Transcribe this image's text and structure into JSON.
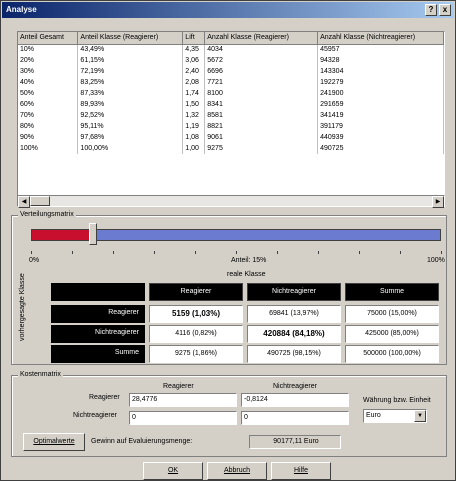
{
  "window": {
    "title": "Analyse",
    "help_icon": "?",
    "close_icon": "x"
  },
  "table": {
    "headers": [
      "Anteil Gesamt",
      "Anteil Klasse (Reagierer)",
      "Lift",
      "Anzahl Klasse (Reagierer)",
      "Anzahl Klasse (Nichtreagierer)"
    ],
    "rows": [
      [
        "10%",
        "43,49%",
        "4,35",
        "4034",
        "45957"
      ],
      [
        "20%",
        "61,15%",
        "3,06",
        "5672",
        "94328"
      ],
      [
        "30%",
        "72,19%",
        "2,40",
        "6696",
        "143304"
      ],
      [
        "40%",
        "83,25%",
        "2,08",
        "7721",
        "192279"
      ],
      [
        "50%",
        "87,33%",
        "1,74",
        "8100",
        "241900"
      ],
      [
        "60%",
        "89,93%",
        "1,50",
        "8341",
        "291659"
      ],
      [
        "70%",
        "92,52%",
        "1,32",
        "8581",
        "341419"
      ],
      [
        "80%",
        "95,11%",
        "1,19",
        "8821",
        "391179"
      ],
      [
        "90%",
        "97,68%",
        "1,08",
        "9061",
        "440939"
      ],
      [
        "100%",
        "100,00%",
        "1,00",
        "9275",
        "490725"
      ]
    ]
  },
  "verteilung": {
    "label": "Verteilungsmatrix",
    "slider_value_percent": 15,
    "scale_min": "0%",
    "scale_max": "100%",
    "scale_caption": "Anteil: 15%",
    "col_caption": "reale Klasse",
    "row_caption": "vorhergesagte Klasse",
    "col_headers": [
      "Reagierer",
      "Nichtreagierer",
      "Summe"
    ],
    "row_headers": [
      "Reagierer",
      "Nichtreagierer",
      "Summe"
    ],
    "cells": [
      [
        "5159 (1,03%)",
        "69841 (13,97%)",
        "75000 (15,00%)"
      ],
      [
        "4116 (0,82%)",
        "420884 (84,18%)",
        "425000 (85,00%)"
      ],
      [
        "9275 (1,86%)",
        "490725 (98,15%)",
        "500000 (100,00%)"
      ]
    ]
  },
  "kosten": {
    "label": "Kostenmatrix",
    "col_headers": [
      "Reagierer",
      "Nichtreagierer"
    ],
    "row_labels": [
      "Reagierer",
      "Nichtreagierer"
    ],
    "values": [
      [
        "28,4776",
        "-0,8124"
      ],
      [
        "0",
        "0"
      ]
    ],
    "currency_label": "Währung bzw. Einheit",
    "currency_value": "Euro",
    "optimal_button": "Optimalwerte",
    "gain_label": "Gewinn auf Evaluierungsmenge:",
    "gain_value": "90177,11 Euro"
  },
  "buttons": {
    "ok": "OK",
    "cancel": "Abbruch",
    "help": "Hilfe"
  }
}
